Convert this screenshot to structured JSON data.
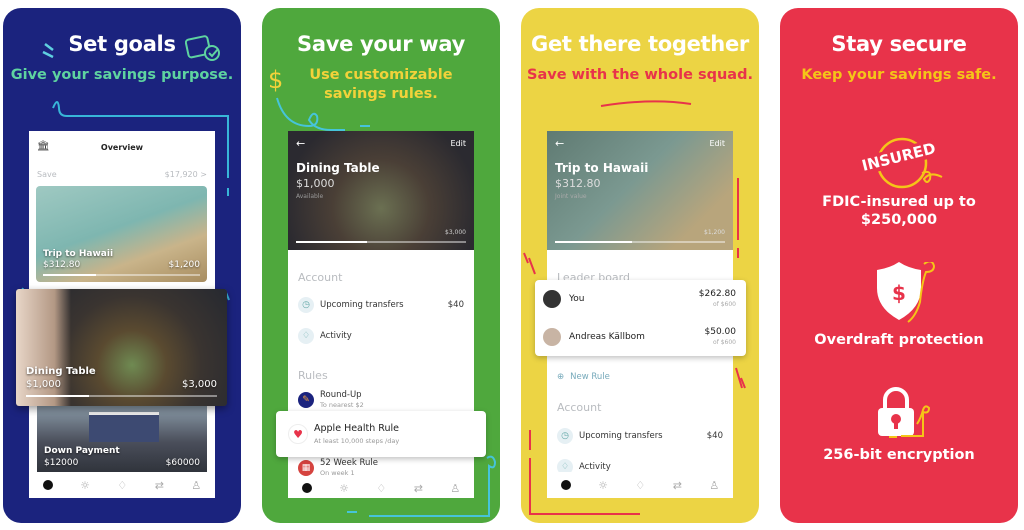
{
  "colors": {
    "blue": "#1b237e",
    "green": "#4fa83d",
    "yellow": "#ecd444",
    "red": "#e8334a",
    "teal": "#5ed3a0"
  },
  "panels": [
    {
      "title": "Set goals",
      "subtitle": "Give your savings purpose.",
      "icon": "calendar-check-icon",
      "screen": {
        "header": "Overview",
        "bank_icon": "bank-icon",
        "save_label": "Save",
        "save_total": "$17,920",
        "chevron": ">",
        "goals": [
          {
            "name": "Trip to Hawaii",
            "saved": "$312.80",
            "target": "$1,200",
            "progress": 0.26
          },
          {
            "name": "Dining Table",
            "saved": "$1,000",
            "target": "$3,000",
            "progress": 0.33
          },
          {
            "name": "Down Payment",
            "saved": "$12000",
            "target": "$60000",
            "progress": 0.2
          }
        ]
      }
    },
    {
      "title": "Save your way",
      "subtitle_line1": "Use customizable",
      "subtitle_line2": "savings rules.",
      "screen": {
        "back": "←",
        "edit": "Edit",
        "goal": "Dining Table",
        "amount": "$1,000",
        "amount_caption": "Available",
        "target": "$3,000",
        "progress": 0.42,
        "account_heading": "Account",
        "upcoming": "Upcoming transfers",
        "upcoming_value": "$40",
        "activity": "Activity",
        "rules_heading": "Rules",
        "rules": [
          {
            "name": "Round-Up",
            "detail": "To nearest $2"
          },
          {
            "name": "Apple Health Rule",
            "detail": "At least 10,000 steps /day"
          },
          {
            "name": "52 Week Rule",
            "detail": "On week 1"
          }
        ]
      }
    },
    {
      "title": "Get there together",
      "subtitle": "Save with the whole squad.",
      "screen": {
        "back": "←",
        "edit": "Edit",
        "goal": "Trip to Hawaii",
        "amount": "$312.80",
        "amount_caption": "Joint value",
        "target": "$1,200",
        "progress": 0.45,
        "leader_heading": "Leader board",
        "leaders": [
          {
            "name": "You",
            "amount": "$262.80",
            "of": "of $600"
          },
          {
            "name": "Andreas Källbom",
            "amount": "$50.00",
            "of": "of $600"
          }
        ],
        "new_rule": "New Rule",
        "account_heading": "Account",
        "upcoming": "Upcoming transfers",
        "upcoming_value": "$40",
        "activity": "Activity"
      }
    },
    {
      "title": "Stay secure",
      "subtitle": "Keep your savings safe.",
      "badge": "INSURED",
      "features": [
        {
          "line1": "FDIC-insured up to",
          "line2": "$250,000"
        },
        {
          "line1": "Overdraft protection"
        },
        {
          "line1": "256-bit encryption"
        }
      ]
    }
  ],
  "tabbar": [
    "home-icon",
    "lightbulb-icon",
    "activity-icon",
    "transfer-icon",
    "profile-icon"
  ]
}
